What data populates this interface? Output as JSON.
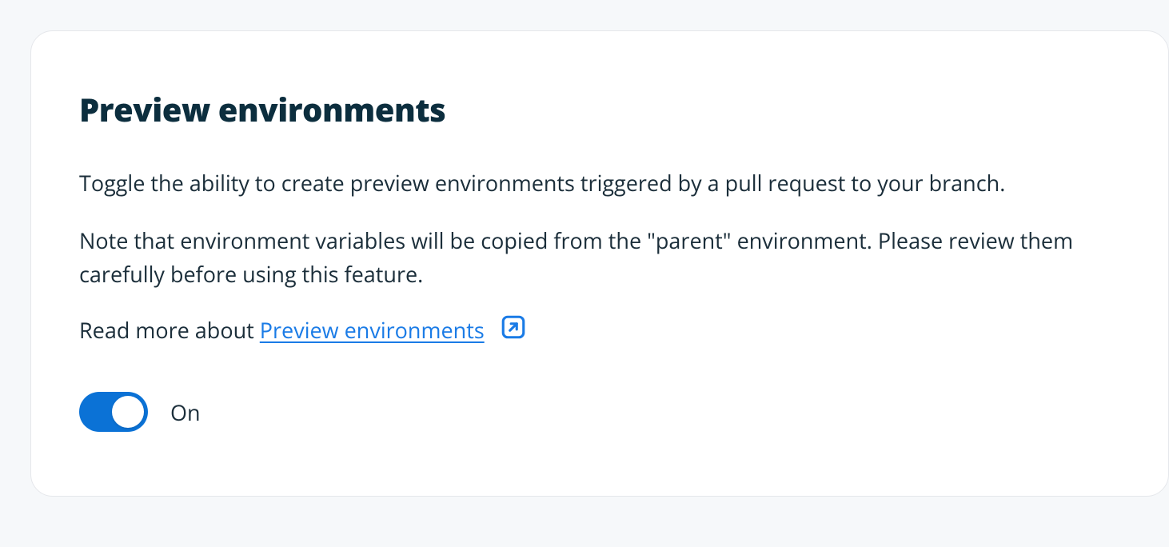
{
  "card": {
    "title": "Preview environments",
    "description1": "Toggle the ability to create preview environments triggered by a pull request to your branch.",
    "description2": "Note that environment variables will be copied from the \"parent\" environment. Please review them carefully before using this feature.",
    "readmore_prefix": "Read more about ",
    "readmore_link_text": "Preview environments",
    "toggle": {
      "state": "on",
      "label": "On"
    }
  },
  "colors": {
    "background": "#f6f8fa",
    "card_bg": "#ffffff",
    "title_text": "#0c2e3e",
    "body_text": "#1b2e3a",
    "link": "#1a7be6",
    "toggle_on": "#0b72d6"
  }
}
